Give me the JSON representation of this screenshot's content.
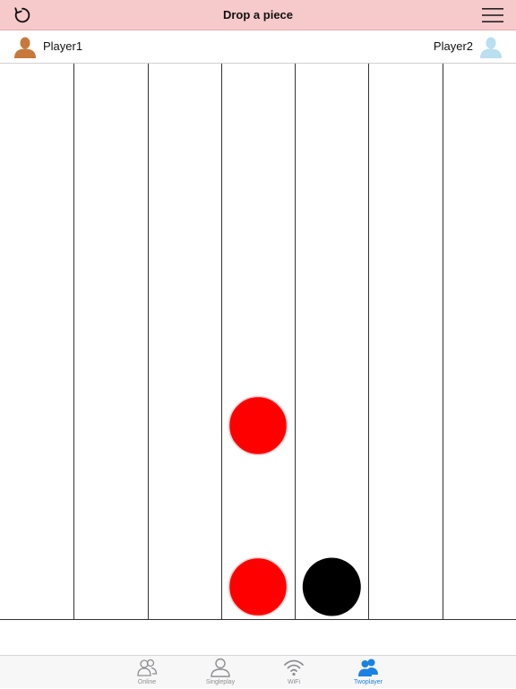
{
  "nav": {
    "title": "Drop a piece",
    "reload_icon": "reload-icon",
    "menu_icon": "hamburger-menu-icon"
  },
  "players": {
    "player1": {
      "name": "Player1",
      "avatar_color": "#c8783a"
    },
    "player2": {
      "name": "Player2",
      "avatar_color": "#b9dff0"
    }
  },
  "board": {
    "columns": 7,
    "pieces": [
      {
        "column": 4,
        "row_from_bottom": 1,
        "color": "red"
      },
      {
        "column": 4,
        "row_from_bottom": 2,
        "color": "red"
      },
      {
        "column": 5,
        "row_from_bottom": 1,
        "color": "black"
      }
    ]
  },
  "colors": {
    "red_piece": "#ff0000",
    "black_piece": "#000000",
    "tab_active": "#1a82e2",
    "tab_inactive": "#8e8e93"
  },
  "tabs": [
    {
      "label": "Online",
      "icon": "online-users-icon",
      "active": false
    },
    {
      "label": "Singleplay",
      "icon": "single-user-icon",
      "active": false
    },
    {
      "label": "WiFi",
      "icon": "wifi-icon",
      "active": false
    },
    {
      "label": "Twoplayer",
      "icon": "two-users-icon",
      "active": true
    }
  ]
}
